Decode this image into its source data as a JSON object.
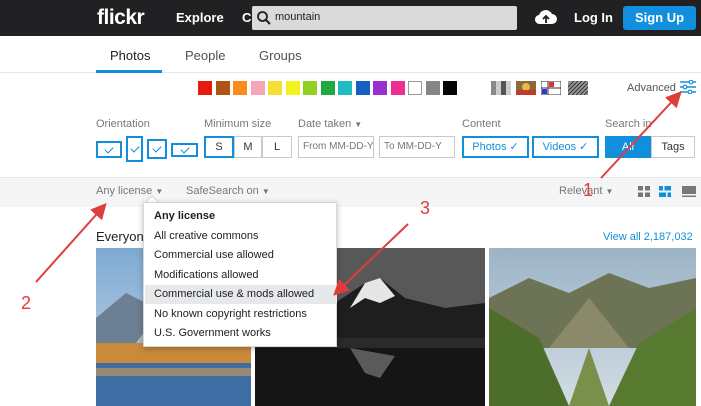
{
  "topbar": {
    "logo": "flickr",
    "explore": "Explore",
    "create": "C",
    "search_value": "mountain",
    "login": "Log In",
    "signup": "Sign Up"
  },
  "tabs": [
    {
      "label": "Photos",
      "active": true
    },
    {
      "label": "People",
      "active": false
    },
    {
      "label": "Groups",
      "active": false
    }
  ],
  "colors": [
    "#e51b0f",
    "#b05416",
    "#fc8a1d",
    "#f7a6b8",
    "#f7de33",
    "#f5f31e",
    "#92cf25",
    "#1fa83e",
    "#1fbcc2",
    "#1660c4",
    "#9b2fcf",
    "#ee2f91",
    "#ffffff",
    "#858585",
    "#050505"
  ],
  "advanced": {
    "label": "Advanced"
  },
  "filters": {
    "orientation": "Orientation",
    "min_size": "Minimum size",
    "size_options": [
      "S",
      "M",
      "L"
    ],
    "date_taken": "Date taken",
    "date_from": "From  MM-DD-Y",
    "date_to": "To    MM-DD-Y",
    "content": "Content",
    "content_photos": "Photos",
    "content_videos": "Videos",
    "search_in": "Search in",
    "search_all": "All",
    "search_tags": "Tags"
  },
  "subbar": {
    "license": "Any license",
    "safesearch": "SafeSearch on",
    "sort": "Relevant"
  },
  "section": {
    "title": "Everyone",
    "view_all": "View all 2,187,032"
  },
  "license_menu": [
    "Any license",
    "All creative commons",
    "Commercial use allowed",
    "Modifications allowed",
    "Commercial use & mods allowed",
    "No known copyright restrictions",
    "U.S. Government works"
  ],
  "annotations": [
    "1",
    "2",
    "3"
  ]
}
